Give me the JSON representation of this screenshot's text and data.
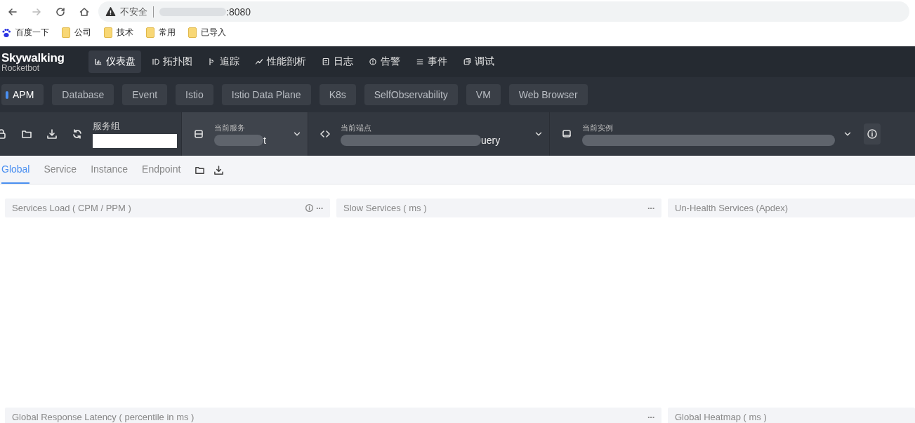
{
  "browser": {
    "security": "不安全",
    "url_tail": ":8080",
    "bookmarks": [
      {
        "label": "百度一下",
        "kind": "paw"
      },
      {
        "label": "公司",
        "kind": "folder"
      },
      {
        "label": "技术",
        "kind": "folder"
      },
      {
        "label": "常用",
        "kind": "folder"
      },
      {
        "label": "已导入",
        "kind": "folder"
      }
    ]
  },
  "logo": {
    "title": "Skywalking",
    "subtitle": "Rocketbot"
  },
  "nav": [
    {
      "label": "仪表盘",
      "selected": true
    },
    {
      "label": "拓扑图",
      "selected": false
    },
    {
      "label": "追踪",
      "selected": false
    },
    {
      "label": "性能剖析",
      "selected": false
    },
    {
      "label": "日志",
      "selected": false
    },
    {
      "label": "告警",
      "selected": false
    },
    {
      "label": "事件",
      "selected": false
    },
    {
      "label": "调试",
      "selected": false
    }
  ],
  "layers": [
    {
      "label": "APM",
      "selected": true
    },
    {
      "label": "Database",
      "selected": false
    },
    {
      "label": "Event",
      "selected": false
    },
    {
      "label": "Istio",
      "selected": false
    },
    {
      "label": "Istio Data Plane",
      "selected": false
    },
    {
      "label": "K8s",
      "selected": false
    },
    {
      "label": "SelfObservability",
      "selected": false
    },
    {
      "label": "VM",
      "selected": false
    },
    {
      "label": "Web Browser",
      "selected": false
    }
  ],
  "service_group": {
    "label": "服务组"
  },
  "selectors": [
    {
      "kind": "service",
      "label": "当前服务",
      "value": "t",
      "active": true
    },
    {
      "kind": "endpoint",
      "label": "当前端点",
      "value": "uery",
      "active": false
    },
    {
      "kind": "instance",
      "label": "当前实例",
      "active": false
    }
  ],
  "dashboard_tabs": [
    {
      "label": "Global",
      "selected": true
    },
    {
      "label": "Service",
      "selected": false
    },
    {
      "label": "Instance",
      "selected": false
    },
    {
      "label": "Endpoint",
      "selected": false
    }
  ],
  "widgets": [
    {
      "title": "Services Load ( CPM / PPM )",
      "info": true,
      "menu": "···"
    },
    {
      "title": "Slow Services ( ms )",
      "info": false,
      "menu": "···"
    },
    {
      "title": "Un-Health Services (Apdex)",
      "info": false
    },
    {
      "title": "Global Response Latency ( percentile in ms )",
      "info": false,
      "menu": "···"
    },
    {
      "title": "Global Heatmap ( ms )",
      "info": false
    }
  ]
}
